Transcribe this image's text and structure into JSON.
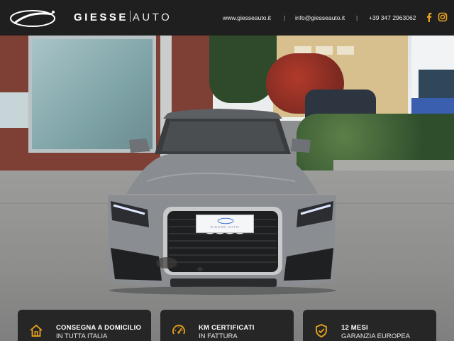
{
  "header": {
    "brand_bold": "GIESSE",
    "brand_light": "AUTO",
    "website": "www.giesseauto.it",
    "email": "info@giesseauto.it",
    "phone": "+39 347 2963062",
    "social_icons": [
      "facebook-icon",
      "instagram-icon"
    ],
    "accent_color": "#e8a21c"
  },
  "vehicle": {
    "plate_text": "GIESSE AUTO",
    "body_color": "#8a8d91"
  },
  "features": [
    {
      "icon": "home-icon",
      "title": "CONSEGNA A DOMICILIO",
      "subtitle": "IN TUTTA ITALIA"
    },
    {
      "icon": "speedometer-icon",
      "title": "KM CERTIFICATI",
      "subtitle": "IN FATTURA"
    },
    {
      "icon": "shield-check-icon",
      "title": "12 MESI",
      "subtitle": "GARANZIA EUROPEA"
    }
  ]
}
